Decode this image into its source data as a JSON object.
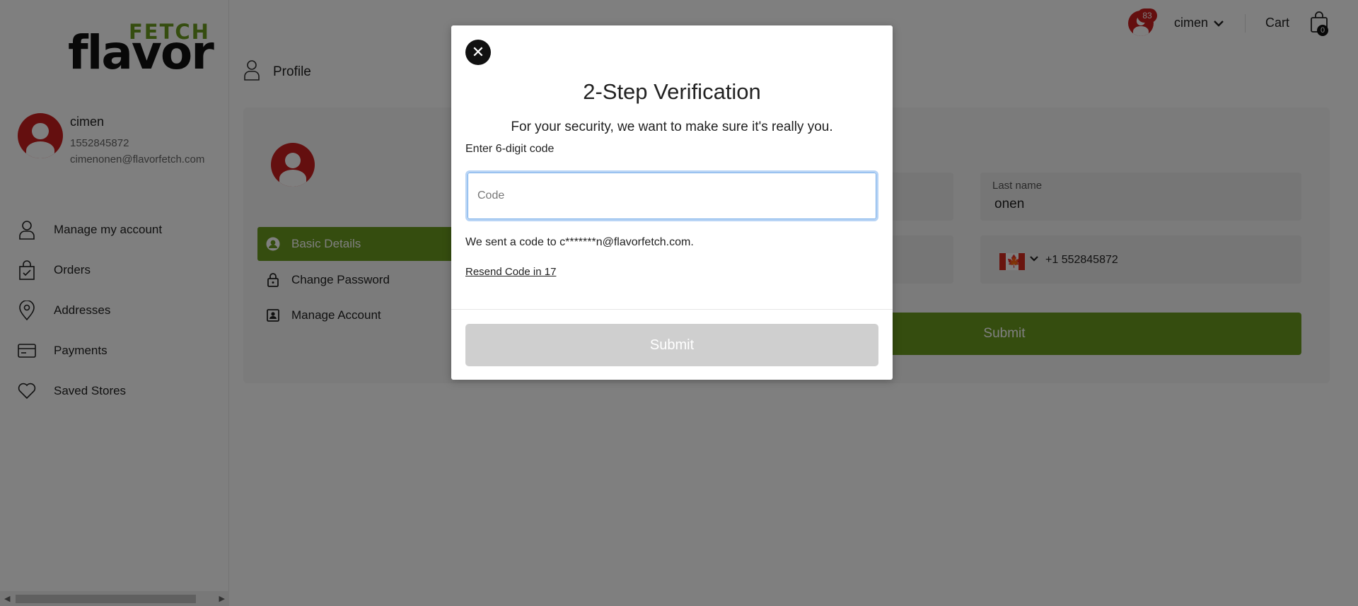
{
  "brand": {
    "logo_top": "FETCH",
    "logo_bottom": "flavor",
    "accent_color": "#6a9a1f",
    "avatar_color": "#c81e1e"
  },
  "sidebar": {
    "user": {
      "name": "cimen",
      "phone": "1552845872",
      "email": "cimenonen@flavorfetch.com"
    },
    "items": [
      {
        "label": "Manage my account",
        "icon": "person-icon"
      },
      {
        "label": "Orders",
        "icon": "bag-check-icon"
      },
      {
        "label": "Addresses",
        "icon": "location-pin-icon"
      },
      {
        "label": "Payments",
        "icon": "credit-card-icon"
      },
      {
        "label": "Saved Stores",
        "icon": "heart-icon"
      }
    ]
  },
  "header": {
    "notification_count": "83",
    "username": "cimen",
    "cart_label": "Cart",
    "cart_count": "0"
  },
  "main": {
    "page_title": "Profile",
    "tabs": [
      {
        "label": "Basic Details",
        "icon": "person-circle-icon"
      },
      {
        "label": "Change Password",
        "icon": "lock-icon"
      },
      {
        "label": "Manage Account",
        "icon": "id-badge-icon"
      }
    ],
    "last_name_label": "Last name",
    "last_name_value": "onen",
    "phone_value": "+1 552845872",
    "submit_label": "Submit"
  },
  "modal": {
    "close_label": "✕",
    "title": "2-Step Verification",
    "subtitle": "For your security, we want to make sure it's really you.",
    "code_label": "Enter 6-digit code",
    "code_placeholder": "Code",
    "sent_text": "We sent a code to c*******n@flavorfetch.com.",
    "resend_text": "Resend Code in 17",
    "submit_label": "Submit"
  }
}
